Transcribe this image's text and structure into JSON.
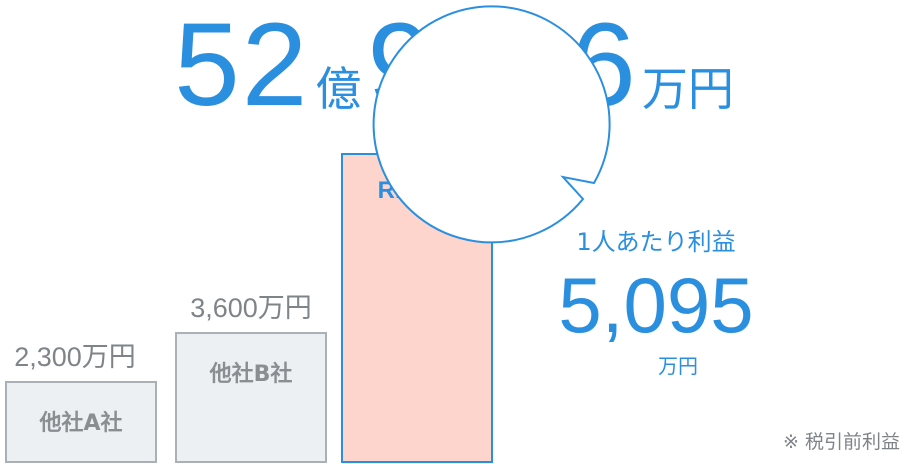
{
  "headline": {
    "oku_number": "52",
    "oku_unit": "億",
    "man_number": "9906",
    "man_unit": "万円"
  },
  "chart_data": {
    "type": "bar",
    "categories": [
      "他社A社",
      "他社B社",
      "RBM"
    ],
    "values": [
      2300,
      3600,
      529906
    ],
    "value_labels": [
      "2,300万円",
      "3,600万円",
      ""
    ],
    "unit": "万円",
    "highlight": "RBM"
  },
  "bubble": {
    "label": "1人あたり利益",
    "value": "5,095",
    "unit": "万円"
  },
  "footnote": "※ 税引前利益",
  "colors": {
    "accent": "#2b8fe0",
    "highlight_fill": "#fdd5cc",
    "highlight_stroke": "#2b8fe0",
    "gray_fill": "#edf0f3",
    "gray_stroke": "#a9b0b6"
  }
}
